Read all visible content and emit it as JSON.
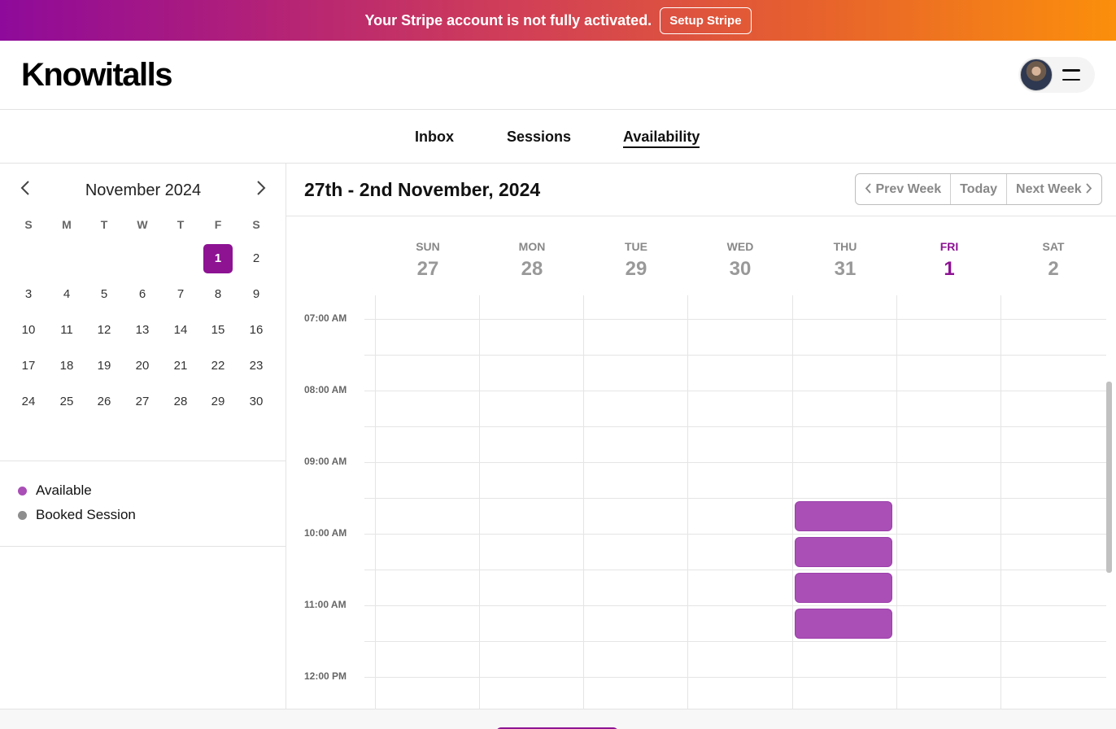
{
  "banner": {
    "message": "Your Stripe account is not fully activated.",
    "button_label": "Setup Stripe"
  },
  "header": {
    "logo_text": "Knowitalls",
    "menu_icon": "hamburger-icon"
  },
  "nav": {
    "tabs": [
      {
        "label": "Inbox"
      },
      {
        "label": "Sessions"
      },
      {
        "label": "Availability",
        "active": true
      }
    ]
  },
  "mini_calendar": {
    "title": "November 2024",
    "prev_icon": "chevron-left-icon",
    "next_icon": "chevron-right-icon",
    "weekday_headers": [
      "S",
      "M",
      "T",
      "W",
      "T",
      "F",
      "S"
    ],
    "selected_day": "1",
    "weeks": [
      [
        "",
        "",
        "",
        "",
        "",
        "1",
        "2"
      ],
      [
        "3",
        "4",
        "5",
        "6",
        "7",
        "8",
        "9"
      ],
      [
        "10",
        "11",
        "12",
        "13",
        "14",
        "15",
        "16"
      ],
      [
        "17",
        "18",
        "19",
        "20",
        "21",
        "22",
        "23"
      ],
      [
        "24",
        "25",
        "26",
        "27",
        "28",
        "29",
        "30"
      ]
    ]
  },
  "legend": [
    {
      "label": "Available",
      "color": "#a94fb6"
    },
    {
      "label": "Booked Session",
      "color": "#8e8e8e"
    }
  ],
  "week_view": {
    "range_title": "27th - 2nd November, 2024",
    "prev_label": "Prev Week",
    "today_label": "Today",
    "next_label": "Next Week",
    "days": [
      {
        "dow": "SUN",
        "date": "27"
      },
      {
        "dow": "MON",
        "date": "28"
      },
      {
        "dow": "TUE",
        "date": "29"
      },
      {
        "dow": "WED",
        "date": "30"
      },
      {
        "dow": "THU",
        "date": "31"
      },
      {
        "dow": "FRI",
        "date": "1",
        "today": true
      },
      {
        "dow": "SAT",
        "date": "2"
      }
    ],
    "time_labels": [
      "07:00 AM",
      "08:00 AM",
      "09:00 AM",
      "10:00 AM",
      "11:00 AM",
      "12:00 PM"
    ],
    "available_slots": [
      {
        "day": "THU",
        "start": "09:30 AM",
        "end": "10:00 AM"
      },
      {
        "day": "THU",
        "start": "10:00 AM",
        "end": "10:30 AM"
      },
      {
        "day": "THU",
        "start": "10:30 AM",
        "end": "11:00 AM"
      },
      {
        "day": "THU",
        "start": "11:00 AM",
        "end": "11:30 AM"
      }
    ]
  },
  "colors": {
    "accent": "#8d1393",
    "available": "#a94fb6"
  }
}
